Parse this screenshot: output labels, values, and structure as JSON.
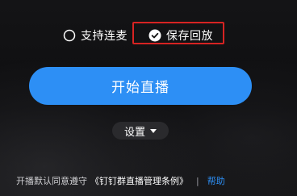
{
  "options": {
    "live_mic_label": "支持连麦",
    "replay_label": "保存回放"
  },
  "start_button_label": "开始直播",
  "settings_label": "设置",
  "footer": {
    "text": "开播默认同意遵守",
    "agreement_link": "《钉钉群直播管理条例》",
    "separator": "|",
    "help_link": "帮助"
  },
  "colors": {
    "accent": "#2d8ff5",
    "highlight_box": "#d72322",
    "background": "#0e0e10"
  }
}
